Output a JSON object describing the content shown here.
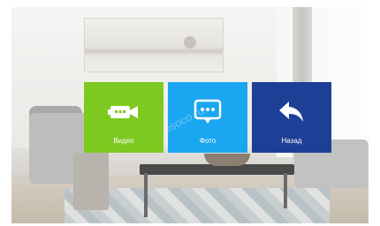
{
  "menu": {
    "tiles": [
      {
        "id": "video",
        "label": "Видео",
        "color": "#7dc91f",
        "icon": "video-camera-icon"
      },
      {
        "id": "photo",
        "label": "Фото",
        "color": "#1aa6f0",
        "icon": "photo-chat-icon"
      },
      {
        "id": "back",
        "label": "Назад",
        "color": "#1e3f96",
        "icon": "back-arrow-icon"
      }
    ]
  },
  "watermark": {
    "text": "esoco.ru"
  }
}
